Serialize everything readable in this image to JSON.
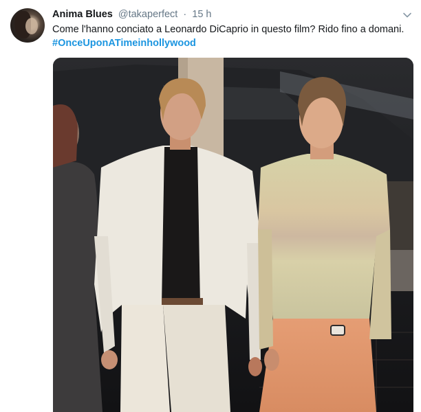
{
  "tweet": {
    "display_name": "Anima Blues",
    "handle": "@takaperfect",
    "separator": "·",
    "time": "15 h",
    "text": "Come l'hanno conciato a Leonardo DiCaprio in questo film? Rido fino a domani.",
    "hashtag": "#OnceUponATimeinhollywood"
  },
  "icons": {
    "avatar": "profile-photo",
    "caret": "chevron-down-icon"
  },
  "colors": {
    "link": "#1b95e0",
    "secondary_text": "#657786",
    "primary_text": "#14171a"
  }
}
